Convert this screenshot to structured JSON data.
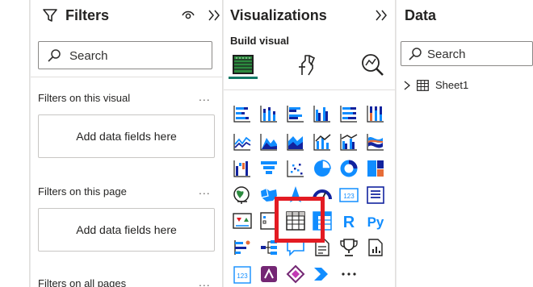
{
  "filters": {
    "title": "Filters",
    "search_placeholder": "Search",
    "sections": [
      {
        "label": "Filters on this visual",
        "more": "...",
        "well": "Add data fields here"
      },
      {
        "label": "Filters on this page",
        "more": "...",
        "well": "Add data fields here"
      },
      {
        "label": "Filters on all pages",
        "more": "..."
      }
    ]
  },
  "visualizations": {
    "title": "Visualizations",
    "build_label": "Build visual",
    "tabs": [
      "build-visual-icon",
      "format-visual-icon",
      "analytics-icon"
    ],
    "more_label": "...",
    "r_label": "R",
    "py_label": "Py",
    "card_label": "123"
  },
  "data_pane": {
    "title": "Data",
    "search_placeholder": "Search",
    "tables": [
      {
        "name": "Sheet1"
      }
    ]
  },
  "colors": {
    "accent_teal": "#117865",
    "viz_blue": "#118dff",
    "viz_dark": "#12239e",
    "highlight_red": "#e31b23"
  }
}
